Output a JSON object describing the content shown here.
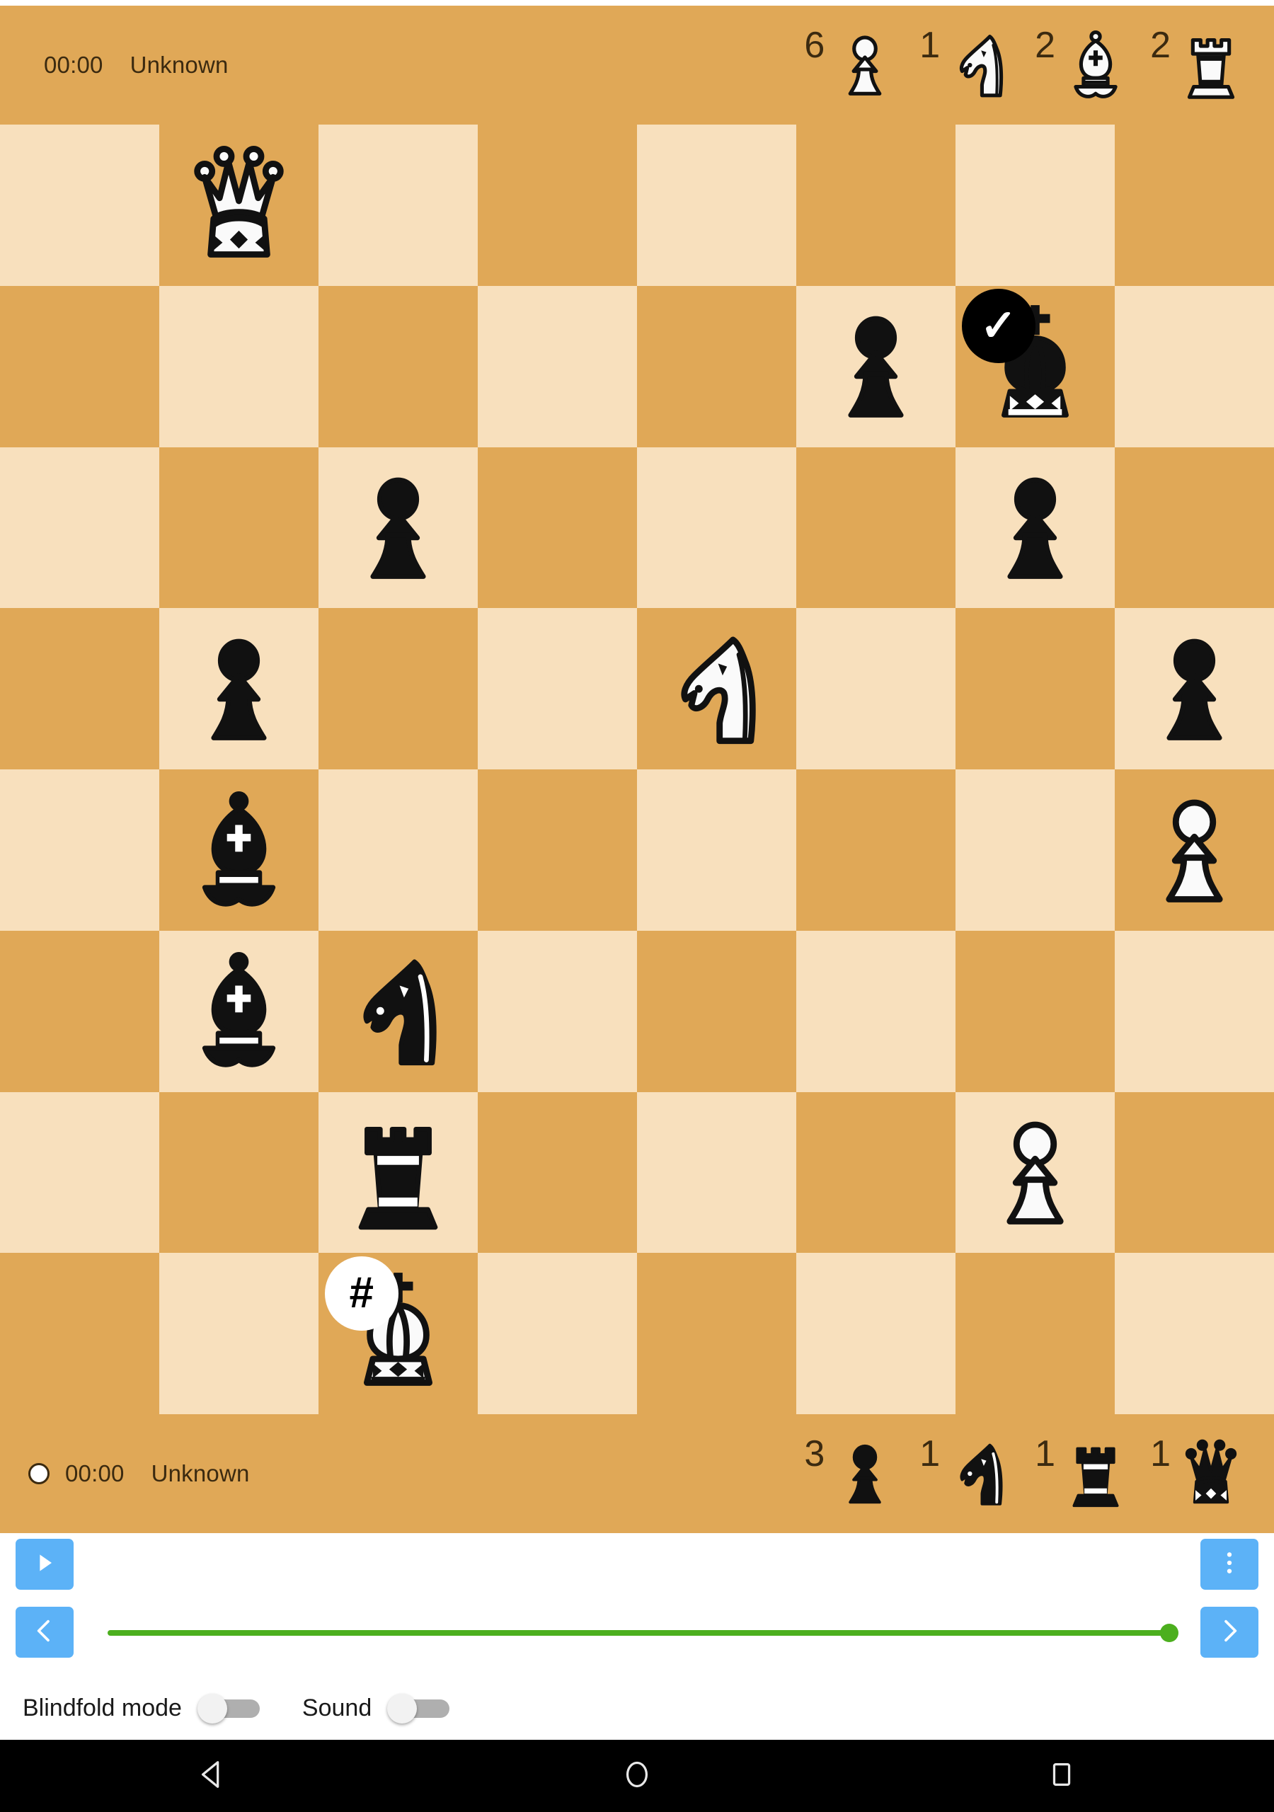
{
  "app": {
    "board": {
      "light_square_color": "#F8E0BD",
      "dark_square_color": "#E0A857",
      "orientation": "white-bottom",
      "squares": [
        [
          null,
          {
            "piece": "white-queen",
            "badge": null
          },
          null,
          null,
          null,
          null,
          null,
          null
        ],
        [
          null,
          null,
          null,
          null,
          null,
          {
            "piece": "black-pawn",
            "badge": null
          },
          {
            "piece": "black-king",
            "badge": "check"
          },
          null
        ],
        [
          null,
          null,
          {
            "piece": "black-pawn",
            "badge": null
          },
          null,
          null,
          null,
          {
            "piece": "black-pawn",
            "badge": null
          },
          null
        ],
        [
          null,
          {
            "piece": "black-pawn",
            "badge": null
          },
          null,
          null,
          {
            "piece": "white-knight",
            "badge": null
          },
          null,
          null,
          {
            "piece": "black-pawn",
            "badge": null
          }
        ],
        [
          null,
          {
            "piece": "black-bishop",
            "badge": null
          },
          null,
          null,
          null,
          null,
          null,
          {
            "piece": "white-pawn",
            "badge": null
          }
        ],
        [
          null,
          {
            "piece": "black-bishop",
            "badge": null
          },
          {
            "piece": "black-knight",
            "badge": null
          },
          null,
          null,
          null,
          null,
          null
        ],
        [
          null,
          null,
          {
            "piece": "black-rook",
            "badge": null
          },
          null,
          null,
          null,
          {
            "piece": "white-pawn",
            "badge": null
          },
          null
        ],
        [
          null,
          null,
          {
            "piece": "white-king",
            "badge": "mate"
          },
          null,
          null,
          null,
          null,
          null
        ]
      ],
      "badge_symbols": {
        "check": "✓",
        "mate": "#"
      }
    },
    "top_player": {
      "clock": "00:00",
      "name": "Unknown",
      "turn_active": false,
      "captured": [
        {
          "piece": "white-pawn",
          "count": "6"
        },
        {
          "piece": "white-knight",
          "count": "1"
        },
        {
          "piece": "white-bishop",
          "count": "2"
        },
        {
          "piece": "white-rook",
          "count": "2"
        }
      ]
    },
    "bottom_player": {
      "clock": "00:00",
      "name": "Unknown",
      "turn_active": true,
      "captured": [
        {
          "piece": "black-pawn",
          "count": "3"
        },
        {
          "piece": "black-knight",
          "count": "1"
        },
        {
          "piece": "black-rook",
          "count": "1"
        },
        {
          "piece": "black-queen",
          "count": "1"
        }
      ]
    },
    "controls": {
      "play_label": "play",
      "more_label": "more-options",
      "prev_label": "previous-move",
      "next_label": "next-move",
      "accent_color": "#5CB2F7",
      "slider": {
        "value_percent": 100,
        "track_color": "#4CAF1E"
      }
    },
    "settings": {
      "blindfold": {
        "label": "Blindfold mode",
        "on": false
      },
      "sound": {
        "label": "Sound",
        "on": false
      }
    },
    "navigation_bar": {
      "back_label": "back",
      "home_label": "home",
      "recents_label": "recents"
    }
  }
}
